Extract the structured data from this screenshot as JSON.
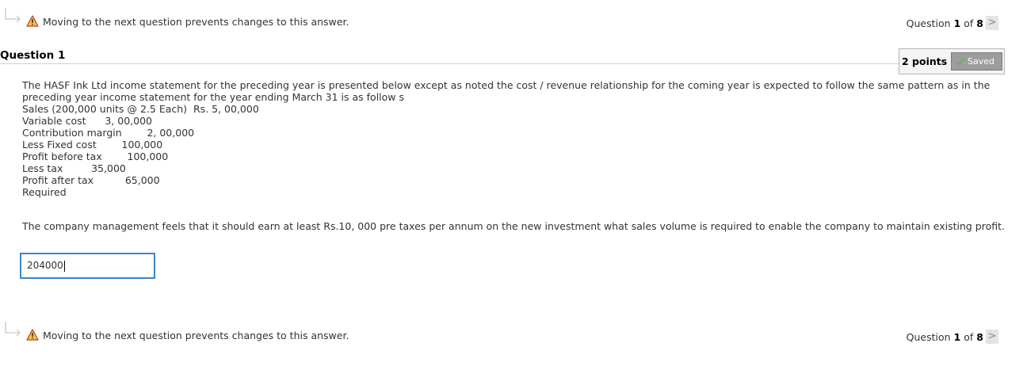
{
  "nav": {
    "warning_text": "Moving to the next question prevents changes to this answer.",
    "question_word": "Question",
    "current": "1",
    "of_word": "of",
    "total": "8",
    "next_glyph": ">"
  },
  "question": {
    "title": "Question 1",
    "points": "2 points",
    "status": "Saved",
    "body_lines": [
      "The HASF Ink Ltd income statement for the preceding year is presented below except as noted the cost / revenue relationship for the coming year is expected to follow the same pattern as in the",
      "preceding year income statement for the year ending March 31 is as follow s",
      "Sales (200,000 units @ 2.5 Each)  Rs. 5, 00,000",
      "Variable cost      3, 00,000",
      "Contribution margin        2, 00,000",
      "Less Fixed cost        100,000",
      "Profit before tax        100,000",
      "Less tax         35,000",
      "Profit after tax          65,000",
      "Required"
    ],
    "prompt": "The company management feels that it should earn at least Rs.10, 000 pre taxes per annum on the new investment what sales volume is required to enable the company to maintain existing profit.",
    "answer_value": "204000"
  },
  "colors": {
    "warning": "#e8a317",
    "input_border": "#3a86c8",
    "saved_badge": "#9d9d9d",
    "check": "#5cb85c"
  },
  "icons": [
    "arrow-icon",
    "warning-icon",
    "check-icon",
    "chevron-right-icon"
  ]
}
